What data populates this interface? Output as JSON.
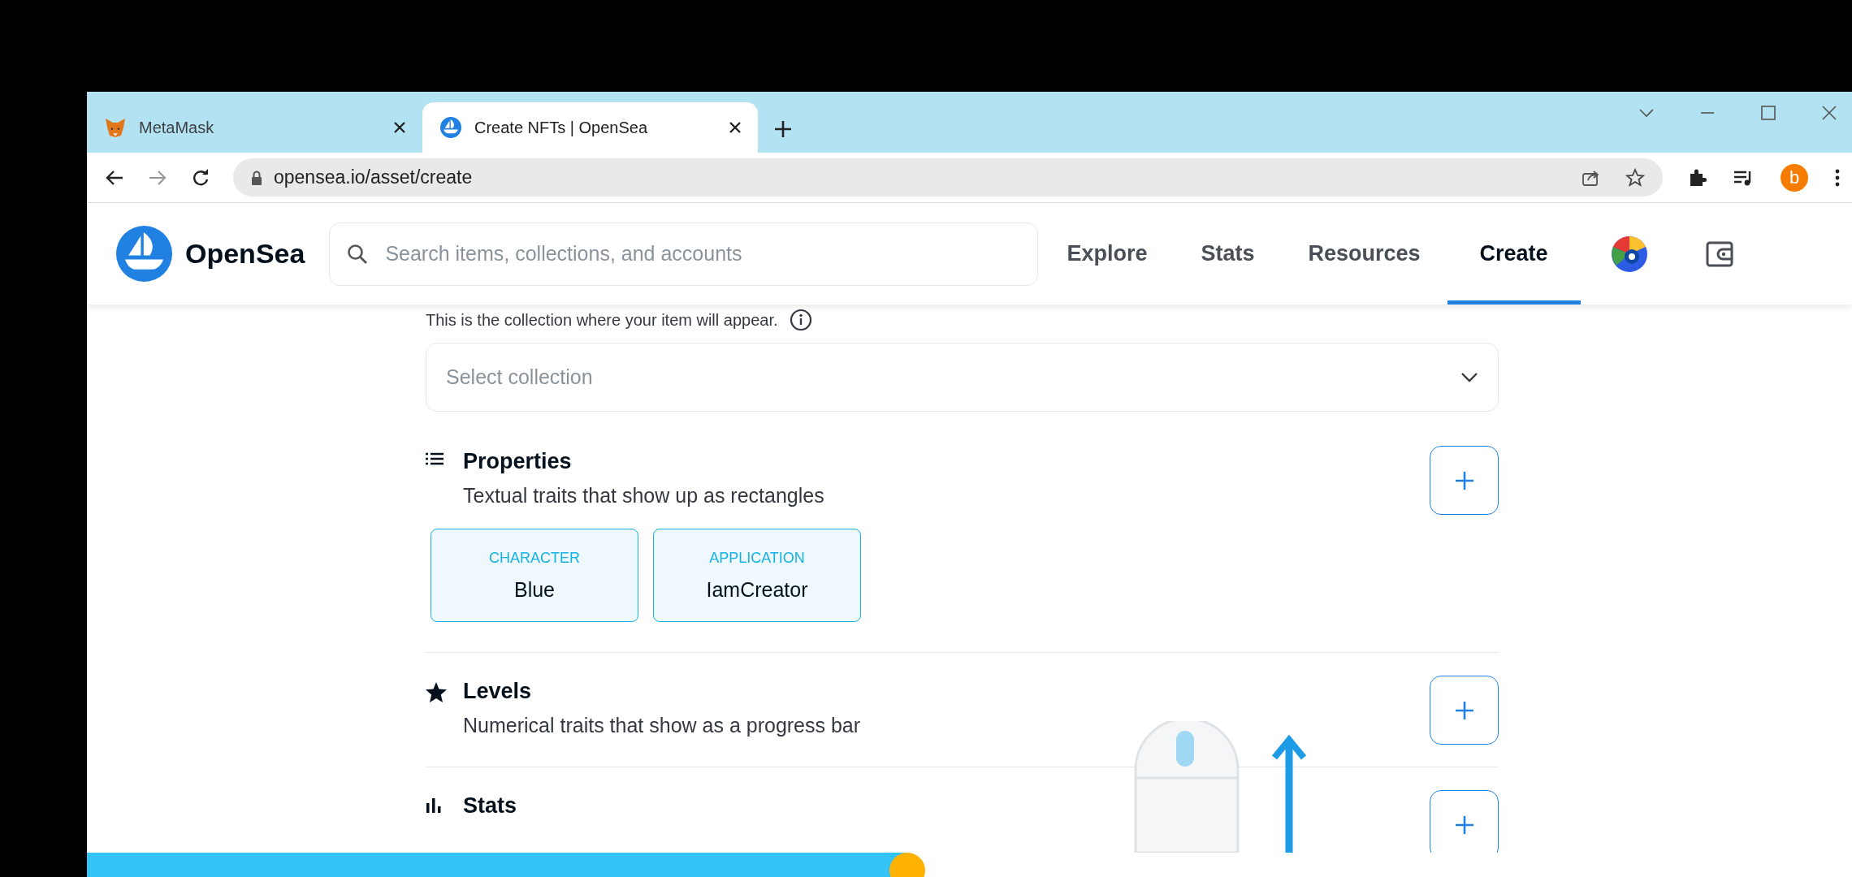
{
  "browser": {
    "tabs": [
      {
        "title": "MetaMask",
        "kind": "fox",
        "selected": false
      },
      {
        "title": "Create NFTs | OpenSea",
        "kind": "ship",
        "selected": true
      }
    ],
    "url": "opensea.io/asset/create",
    "profile_initial": "b"
  },
  "site": {
    "logo": "OpenSea",
    "search": {
      "placeholder": "Search items, collections, and accounts"
    },
    "nav": [
      {
        "label": "Explore",
        "selected": false
      },
      {
        "label": "Stats",
        "selected": false
      },
      {
        "label": "Resources",
        "selected": false
      },
      {
        "label": "Create",
        "selected": true
      }
    ]
  },
  "form": {
    "collection_hint": "This is the collection where your item will appear.",
    "collection_select": {
      "placeholder": "Select collection"
    },
    "sections": [
      {
        "kind": "properties",
        "title": "Properties",
        "description": "Textual traits that show up as rectangles",
        "traits": [
          {
            "type": "CHARACTER",
            "value": "Blue"
          },
          {
            "type": "APPLICATION",
            "value": "IamCreator"
          }
        ]
      },
      {
        "kind": "levels",
        "title": "Levels",
        "description": "Numerical traits that show as a progress bar"
      },
      {
        "kind": "stats",
        "title": "Stats"
      }
    ]
  },
  "video": {
    "level": 0.465
  }
}
